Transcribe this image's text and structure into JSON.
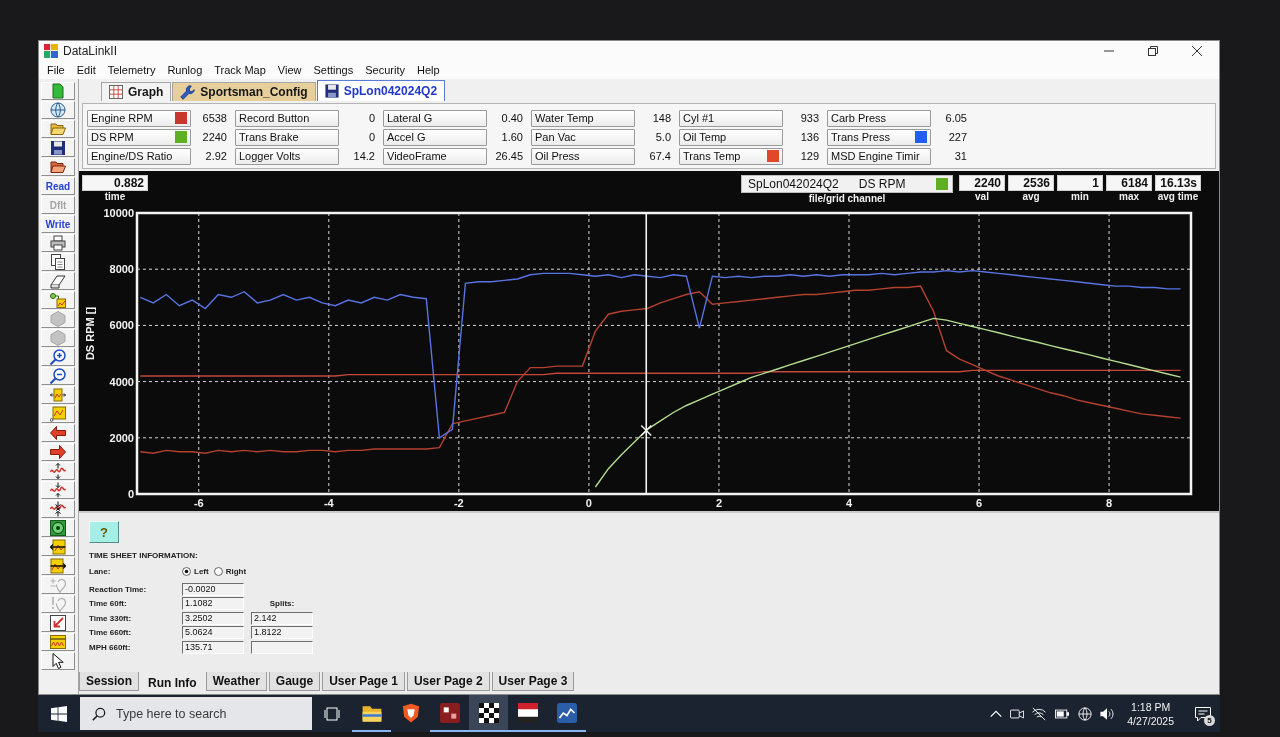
{
  "window": {
    "title": "DataLinkII"
  },
  "menu": [
    "File",
    "Edit",
    "Telemetry",
    "Runlog",
    "Track Map",
    "View",
    "Settings",
    "Security",
    "Help"
  ],
  "toolbar": [
    {
      "kind": "new",
      "disabled": false
    },
    {
      "kind": "disc",
      "disabled": false
    },
    {
      "kind": "open",
      "disabled": false
    },
    {
      "kind": "save",
      "disabled": false
    },
    {
      "kind": "recent",
      "disabled": false
    },
    {
      "kind": "text",
      "label": "Read",
      "disabled": false
    },
    {
      "kind": "text",
      "label": "Dflt",
      "disabled": true
    },
    {
      "kind": "text",
      "label": "Write",
      "disabled": false
    },
    {
      "kind": "print",
      "disabled": false
    },
    {
      "kind": "copy",
      "disabled": false
    },
    {
      "kind": "erase",
      "disabled": false
    },
    {
      "kind": "channels",
      "disabled": false
    },
    {
      "kind": "hex",
      "disabled": true
    },
    {
      "kind": "hex",
      "disabled": true
    },
    {
      "kind": "zoom_in",
      "disabled": false
    },
    {
      "kind": "zoom_out",
      "disabled": false
    },
    {
      "kind": "span",
      "disabled": false
    },
    {
      "kind": "scale",
      "disabled": false
    },
    {
      "kind": "back",
      "disabled": false
    },
    {
      "kind": "forward",
      "disabled": false
    },
    {
      "kind": "wave_up",
      "disabled": false
    },
    {
      "kind": "wave_down",
      "disabled": false
    },
    {
      "kind": "wave_pinch",
      "disabled": false
    },
    {
      "kind": "target",
      "disabled": false
    },
    {
      "kind": "shift_left",
      "disabled": false
    },
    {
      "kind": "shift_right",
      "disabled": false
    },
    {
      "kind": "plus_heart",
      "disabled": true
    },
    {
      "kind": "bar_heart",
      "disabled": true
    },
    {
      "kind": "marker",
      "disabled": false
    },
    {
      "kind": "overlay",
      "disabled": false
    },
    {
      "kind": "help",
      "disabled": false
    }
  ],
  "tabs": [
    {
      "kind": "graph",
      "label": "Graph",
      "selected": false
    },
    {
      "kind": "config",
      "label": "Sportsman_Config",
      "selected": false
    },
    {
      "kind": "file",
      "label": "SpLon042024Q2",
      "selected": true
    }
  ],
  "channels": [
    {
      "label": "Engine RPM",
      "value": "6538",
      "color": "#c8372d"
    },
    {
      "label": "Record Button",
      "value": "0"
    },
    {
      "label": "Lateral G",
      "value": "0.40"
    },
    {
      "label": "Water Temp",
      "value": "148"
    },
    {
      "label": "Cyl #1",
      "value": "933"
    },
    {
      "label": "Carb Press",
      "value": "6.05"
    },
    {
      "label": "DS RPM",
      "value": "2240",
      "color": "#5cb021"
    },
    {
      "label": "Trans Brake",
      "value": "0"
    },
    {
      "label": "Accel G",
      "value": "1.60"
    },
    {
      "label": "Pan Vac",
      "value": "5.0"
    },
    {
      "label": "Oil Temp",
      "value": "136"
    },
    {
      "label": "Trans Press",
      "value": "227",
      "color": "#1d5ff0"
    },
    {
      "label": "Engine/DS Ratio",
      "value": "2.92"
    },
    {
      "label": "Logger Volts",
      "value": "14.2"
    },
    {
      "label": "VideoFrame",
      "value": "26.45"
    },
    {
      "label": "Oil Press",
      "value": "67.4"
    },
    {
      "label": "Trans Temp",
      "value": "129",
      "color": "#e2472b"
    },
    {
      "label": "MSD Engine Timir",
      "value": "31"
    }
  ],
  "graph": {
    "time": {
      "value": "0.882",
      "label": "time"
    },
    "channel_selector": {
      "file": "SpLon042024Q2",
      "channel": "DS RPM",
      "color": "#5cb021",
      "label": "file/grid channel"
    },
    "readouts": [
      {
        "value": "2240",
        "label": "val"
      },
      {
        "value": "2536",
        "label": "avg"
      },
      {
        "value": "1",
        "label": "min"
      },
      {
        "value": "6184",
        "label": "max"
      },
      {
        "value": "16.13s",
        "label": "avg time"
      }
    ],
    "chart_data": {
      "type": "line",
      "ylabel": "DS RPM []",
      "grid": true,
      "x": [
        -6.9,
        -6.7,
        -6.5,
        -6.3,
        -6.1,
        -5.9,
        -5.7,
        -5.5,
        -5.3,
        -5.1,
        -4.9,
        -4.7,
        -4.5,
        -4.3,
        -4.1,
        -3.9,
        -3.7,
        -3.5,
        -3.3,
        -3.1,
        -2.9,
        -2.7,
        -2.5,
        -2.3,
        -2.1,
        -1.9,
        -1.7,
        -1.5,
        -1.3,
        -1.1,
        -0.9,
        -0.7,
        -0.5,
        -0.3,
        -0.1,
        0.1,
        0.3,
        0.5,
        0.7,
        0.9,
        1.1,
        1.3,
        1.5,
        1.7,
        1.9,
        2.1,
        2.3,
        2.5,
        2.7,
        2.9,
        3.1,
        3.3,
        3.5,
        3.7,
        3.9,
        4.1,
        4.3,
        4.5,
        4.7,
        4.9,
        5.1,
        5.3,
        5.5,
        5.7,
        5.9,
        6.1,
        6.3,
        6.5,
        6.7,
        6.9,
        7.1,
        7.3,
        7.5,
        7.7,
        7.9,
        8.1,
        8.3,
        8.5,
        8.7,
        8.9,
        9.1
      ],
      "xlim": [
        -6.95,
        9.26
      ],
      "ylim": [
        0,
        10000
      ],
      "xticks": [
        -6,
        -4,
        -2,
        0,
        2,
        4,
        6,
        8
      ],
      "yticks": [
        0,
        2000,
        4000,
        6000,
        8000,
        10000
      ],
      "series": [
        {
          "color": "#c4473a",
          "values": [
            4200,
            4200,
            4200,
            4200,
            4200,
            4200,
            4200,
            4200,
            4200,
            4200,
            4200,
            4200,
            4200,
            4200,
            4200,
            4200,
            4250,
            4250,
            4250,
            4250,
            4250,
            4250,
            4250,
            4250,
            4250,
            4250,
            4250,
            4250,
            4250,
            4250,
            4250,
            4250,
            4300,
            4300,
            4300,
            4300,
            4300,
            4300,
            4300,
            4300,
            4300,
            4300,
            4300,
            4300,
            4300,
            4300,
            4300,
            4300,
            4350,
            4350,
            4350,
            4350,
            4350,
            4350,
            4350,
            4350,
            4350,
            4350,
            4350,
            4350,
            4350,
            4350,
            4350,
            4350,
            4400,
            4400,
            4400,
            4400,
            4400,
            4400,
            4400,
            4400,
            4400,
            4400,
            4400,
            4400,
            4400,
            4400,
            4400,
            4400,
            4400
          ]
        },
        {
          "color": "#b5412f",
          "values": [
            1500,
            1450,
            1550,
            1500,
            1500,
            1450,
            1550,
            1500,
            1550,
            1500,
            1550,
            1500,
            1500,
            1550,
            1550,
            1500,
            1550,
            1550,
            1600,
            1600,
            1600,
            1600,
            1600,
            1650,
            2500,
            2600,
            2700,
            2800,
            2900,
            4000,
            4500,
            4500,
            4550,
            4550,
            4550,
            5800,
            6400,
            6500,
            6550,
            6600,
            6800,
            6950,
            7100,
            7200,
            6750,
            6800,
            6850,
            6900,
            6950,
            7000,
            7050,
            7100,
            7100,
            7150,
            7200,
            7250,
            7250,
            7300,
            7350,
            7350,
            7400,
            6500,
            5100,
            4800,
            4600,
            4400,
            4200,
            4050,
            3900,
            3750,
            3600,
            3500,
            3350,
            3250,
            3150,
            3050,
            2950,
            2850,
            2800,
            2750,
            2700
          ]
        },
        {
          "color": "#5874e2",
          "values": [
            7000,
            6800,
            7100,
            6700,
            6900,
            6600,
            7100,
            7000,
            7200,
            6800,
            6900,
            7100,
            6900,
            7000,
            6800,
            6700,
            6900,
            6800,
            7000,
            6900,
            7100,
            7000,
            6950,
            2000,
            2300,
            7500,
            7550,
            7550,
            7600,
            7650,
            7800,
            7850,
            7850,
            7850,
            7800,
            7750,
            7800,
            7700,
            7800,
            7750,
            7700,
            7800,
            7750,
            5900,
            7750,
            7700,
            7750,
            7700,
            7750,
            7750,
            7800,
            7750,
            7800,
            7750,
            7800,
            7800,
            7800,
            7850,
            7800,
            7850,
            7900,
            7900,
            7950,
            7900,
            7950,
            7900,
            7850,
            7800,
            7750,
            7700,
            7650,
            7600,
            7550,
            7500,
            7450,
            7400,
            7400,
            7350,
            7350,
            7300,
            7300
          ]
        },
        {
          "color": "#b4dc8e",
          "values": [
            null,
            null,
            null,
            null,
            null,
            null,
            null,
            null,
            null,
            null,
            null,
            null,
            null,
            null,
            null,
            null,
            null,
            null,
            null,
            null,
            null,
            null,
            null,
            null,
            null,
            null,
            null,
            null,
            null,
            null,
            null,
            null,
            null,
            null,
            null,
            250,
            900,
            1400,
            1850,
            2300,
            2600,
            2900,
            3150,
            3350,
            3550,
            3750,
            3950,
            4150,
            4300,
            4450,
            4600,
            4750,
            4900,
            5050,
            5200,
            5350,
            5500,
            5650,
            5800,
            5950,
            6100,
            6250,
            6190,
            6070,
            5960,
            5850,
            5740,
            5620,
            5510,
            5400,
            5280,
            5170,
            5060,
            4950,
            4830,
            4720,
            4610,
            4490,
            4380,
            4270,
            4160
          ]
        }
      ],
      "ref_lines": [
        {
          "axis": "x",
          "value": 0.882
        }
      ]
    }
  },
  "run_info": {
    "help_button": "?",
    "heading": "TIME SHEET INFORMATION:",
    "lane": {
      "label": "Lane:",
      "options": [
        {
          "label": "Left",
          "selected": true
        },
        {
          "label": "Right",
          "selected": false
        }
      ]
    },
    "splits_label": "Splits:",
    "rows": [
      {
        "label": "Reaction Time:",
        "value": "-0.0020",
        "split_field": false
      },
      {
        "label": "Time 60ft:",
        "value": "1.1082",
        "split_field": false
      },
      {
        "label": "Time 330ft:",
        "value": "3.2502",
        "split_field": true,
        "split": "2.142"
      },
      {
        "label": "Time 660ft:",
        "value": "5.0624",
        "split_field": true,
        "split": "1.8122"
      },
      {
        "label": "MPH 660ft:",
        "value": "135.71",
        "split_field": true
      }
    ]
  },
  "bottom_tabs": [
    {
      "label": "Session",
      "selected": false
    },
    {
      "label": "Run Info",
      "selected": true
    },
    {
      "label": "Weather",
      "selected": false
    },
    {
      "label": "Gauge",
      "selected": false
    },
    {
      "label": "User Page 1",
      "selected": false
    },
    {
      "label": "User Page 2",
      "selected": false
    },
    {
      "label": "User Page 3",
      "selected": false
    }
  ],
  "taskbar": {
    "search": {
      "placeholder": "Type here to search"
    },
    "apps": [
      {
        "kind": "folder",
        "running": true,
        "selected": false
      },
      {
        "kind": "shield",
        "running": false,
        "selected": false
      },
      {
        "kind": "tile",
        "running": true,
        "selected": false
      },
      {
        "kind": "flag",
        "running": true,
        "selected": true
      },
      {
        "kind": "document",
        "running": true,
        "selected": false
      },
      {
        "kind": "chart",
        "running": true,
        "selected": false
      }
    ],
    "time": "1:18 PM",
    "date": "4/27/2025",
    "notifications": "5"
  }
}
